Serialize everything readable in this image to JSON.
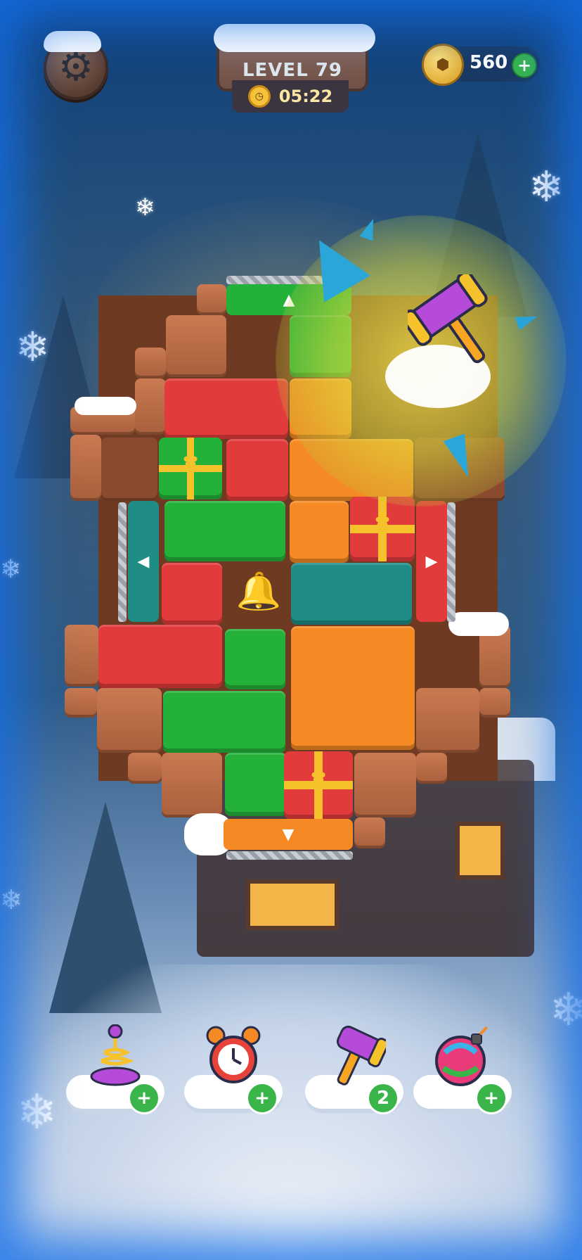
{
  "header": {
    "settings_icon": "gear-icon",
    "level_label": "LEVEL 79",
    "timer_icon": "clock-icon",
    "timer_value": "05:22",
    "coins_icon": "coin-icon",
    "coins_value": "560",
    "coins_add": "+"
  },
  "board": {
    "up_arrow": "▲",
    "down_arrow": "▼",
    "left_arrow": "◀",
    "right_arrow": "▶",
    "special_icons": [
      "gift-icon",
      "bell-icon",
      "hammer-icon"
    ]
  },
  "colors": {
    "red": "#e23b3b",
    "green": "#24b13a",
    "orange": "#f58a24",
    "teal": "#1f8c86",
    "wood": "#c97a52",
    "accent_green": "#39b54a"
  },
  "boosters": [
    {
      "name": "spring-booster",
      "icon": "spring-icon",
      "badge": "+"
    },
    {
      "name": "freeze-time-booster",
      "icon": "alarm-clock-icon",
      "badge": "+"
    },
    {
      "name": "hammer-booster",
      "icon": "hammer-icon",
      "badge": "2"
    },
    {
      "name": "bomb-booster",
      "icon": "bomb-icon",
      "badge": "+"
    }
  ]
}
